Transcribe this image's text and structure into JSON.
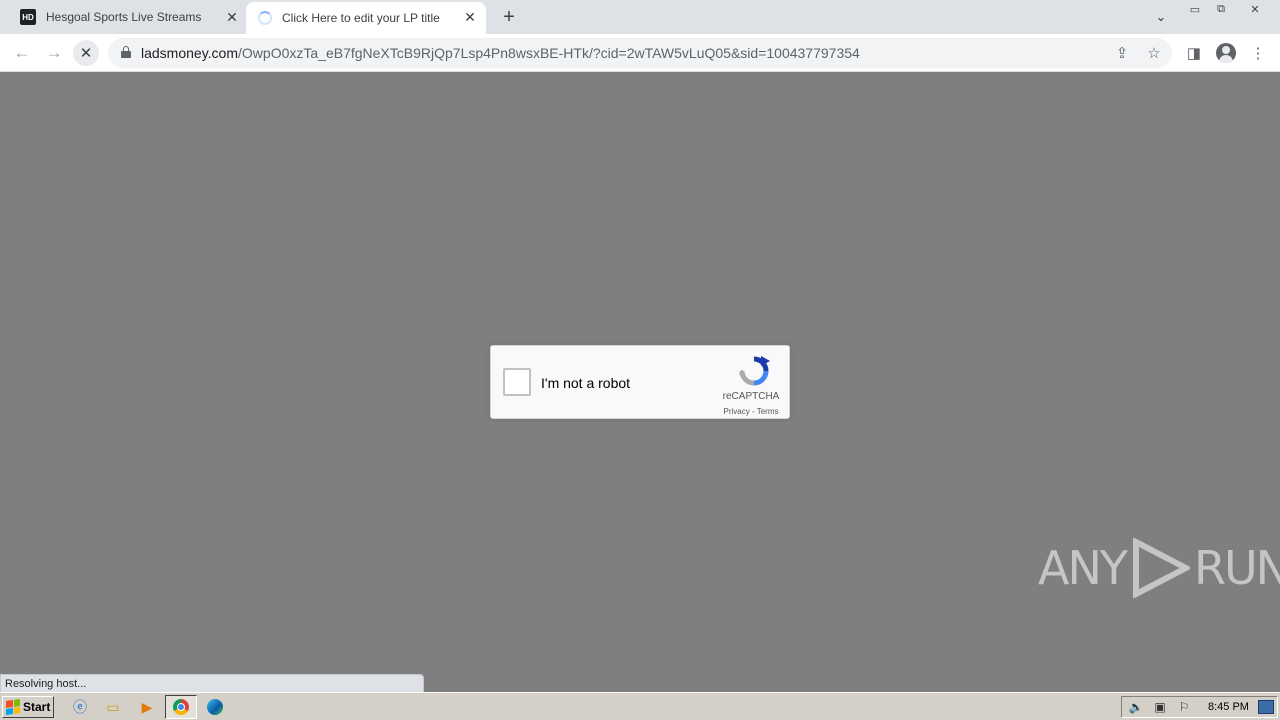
{
  "browser": {
    "tabs": [
      {
        "title": "Hesgoal Sports Live Streams",
        "favicon": "HD",
        "active": false
      },
      {
        "title": "Click Here to edit your LP title",
        "loading": true,
        "active": true
      }
    ],
    "url_host": "ladsmoney.com",
    "url_path": "/OwpO0xzTa_eB7fgNeXTcB9RjQp7Lsp4Pn8wsxBE-HTk/?cid=2wTAW5vLuQ05&sid=100437797354",
    "status_text": "Resolving host..."
  },
  "recaptcha": {
    "label": "I'm not a robot",
    "brand": "reCAPTCHA",
    "privacy": "Privacy",
    "separator": " - ",
    "terms": "Terms"
  },
  "watermark": {
    "left": "ANY",
    "right": "RUN"
  },
  "taskbar": {
    "start_label": "Start",
    "clock": "8:45 PM"
  },
  "icons": {
    "back": "back-arrow-icon",
    "forward": "forward-arrow-icon",
    "stop": "stop-icon",
    "share": "share-icon",
    "bookmark": "star-icon",
    "sidepanel": "side-panel-icon",
    "profile": "profile-icon",
    "menu": "more-vert-icon"
  },
  "colors": {
    "page_background": "#7f7f7f",
    "tabbar": "#dee1e6",
    "taskbar": "#d4d0c8"
  }
}
